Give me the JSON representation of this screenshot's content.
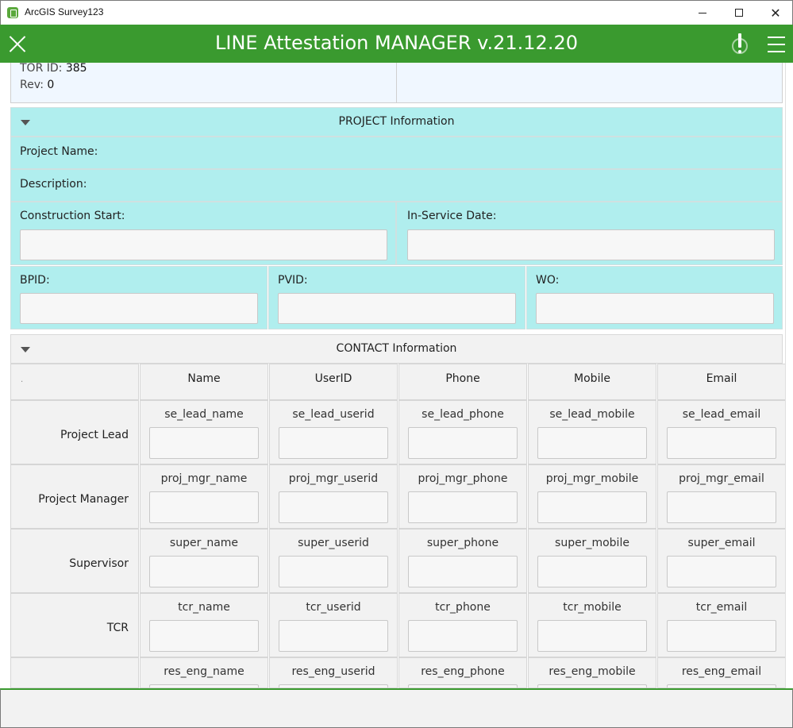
{
  "window": {
    "app_title": "ArcGIS Survey123"
  },
  "header": {
    "title": "LINE Attestation MANAGER v.21.12.20"
  },
  "tor": {
    "id_label": "TOR ID:",
    "id_value": "385",
    "rev_label": "Rev:",
    "rev_value": "0"
  },
  "project": {
    "heading": "PROJECT Information",
    "name_label": "Project Name:",
    "description_label": "Description:",
    "construction_start_label": "Construction Start:",
    "in_service_label": "In-Service Date:",
    "bpid_label": "BPID:",
    "pvid_label": "PVID:",
    "wo_label": "WO:"
  },
  "contact": {
    "heading": "CONTACT Information",
    "corner": ".",
    "columns": [
      "Name",
      "UserID",
      "Phone",
      "Mobile",
      "Email"
    ],
    "rows": [
      {
        "label": "Project Lead",
        "fields": [
          "se_lead_name",
          "se_lead_userid",
          "se_lead_phone",
          "se_lead_mobile",
          "se_lead_email"
        ]
      },
      {
        "label": "Project Manager",
        "fields": [
          "proj_mgr_name",
          "proj_mgr_userid",
          "proj_mgr_phone",
          "proj_mgr_mobile",
          "proj_mgr_email"
        ]
      },
      {
        "label": "Supervisor",
        "fields": [
          "super_name",
          "super_userid",
          "super_phone",
          "super_mobile",
          "super_email"
        ]
      },
      {
        "label": "TCR",
        "fields": [
          "tcr_name",
          "tcr_userid",
          "tcr_phone",
          "tcr_mobile",
          "tcr_email"
        ]
      },
      {
        "label": "",
        "fields": [
          "res_eng_name",
          "res_eng_userid",
          "res_eng_phone",
          "res_eng_mobile",
          "res_eng_email"
        ]
      }
    ]
  }
}
